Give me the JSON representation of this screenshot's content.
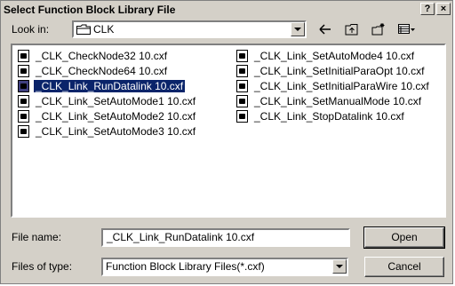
{
  "dialog": {
    "title": "Select Function Block Library File",
    "help_label": "?",
    "close_label": "×"
  },
  "lookin": {
    "label": "Look in:",
    "value": "CLK"
  },
  "files_col1": [
    "_CLK_CheckNode32 10.cxf",
    "_CLK_CheckNode64 10.cxf",
    "_CLK_Link_RunDatalink 10.cxf",
    "_CLK_Link_SetAutoMode1 10.cxf",
    "_CLK_Link_SetAutoMode2 10.cxf",
    "_CLK_Link_SetAutoMode3 10.cxf"
  ],
  "files_col2": [
    "_CLK_Link_SetAutoMode4 10.cxf",
    "_CLK_Link_SetInitialParaOpt 10.cxf",
    "_CLK_Link_SetInitialParaWire 10.cxf",
    "_CLK_Link_SetManualMode 10.cxf",
    "_CLK_Link_StopDatalink 10.cxf"
  ],
  "selected_file": "_CLK_Link_RunDatalink 10.cxf",
  "filename": {
    "label": "File name:",
    "value": "_CLK_Link_RunDatalink 10.cxf"
  },
  "filetype": {
    "label": "Files of type:",
    "value": "Function Block Library Files(*.cxf)"
  },
  "buttons": {
    "open": "Open",
    "cancel": "Cancel"
  },
  "colors": {
    "dialog_bg": "#d4d0c8",
    "selection": "#0a246a"
  }
}
